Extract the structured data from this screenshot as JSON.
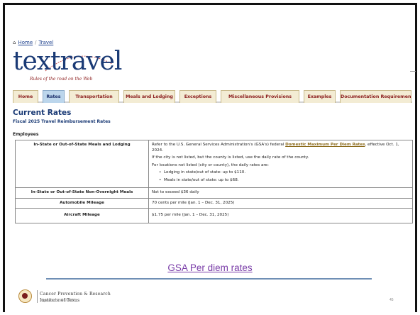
{
  "breadcrumb": {
    "home": "Home",
    "separator": "/",
    "current": "Travel"
  },
  "logo": {
    "wordmark": "textravel",
    "tagline": "Rules of the road on the Web"
  },
  "nav": {
    "tabs": [
      {
        "label": "Home",
        "active": false
      },
      {
        "label": "Rates",
        "active": true
      },
      {
        "label": "Transportation",
        "active": false
      },
      {
        "label": "Meals and Lodging",
        "active": false
      },
      {
        "label": "Exceptions",
        "active": false
      },
      {
        "label": "Miscellaneous Provisions",
        "active": false
      },
      {
        "label": "Examples",
        "active": false
      },
      {
        "label": "Documentation Requirements",
        "active": false
      }
    ]
  },
  "page": {
    "title": "Current Rates",
    "subtitle": "Fiscal 2025 Travel Reimbursement Rates",
    "section": "Employees"
  },
  "rates": {
    "row1": {
      "label": "In-State or Out-of-State Meals and Lodging",
      "p1_before": "Refer to the U.S. General Services Administration's (GSA's) federal ",
      "p1_link": "Domestic Maximum Per Diem Rates",
      "p1_after": ", effective Oct. 1, 2024.",
      "p2": "If the city is not listed, but the county is listed, use the daily rate of the county.",
      "p3": "For locations not listed (city or county), the daily rates are:",
      "bullet1": "Lodging in state/out of state: up to $110.",
      "bullet2": "Meals in state/out of state: up to $68."
    },
    "row2": {
      "label": "In-State or Out-of-State Non-Overnight Meals",
      "value": "Not to exceed $36 daily"
    },
    "row3": {
      "label": "Automobile Mileage",
      "value": "70 cents per mile (Jan. 1 – Dec. 31, 2025)"
    },
    "row4": {
      "label": "Aircraft Mileage",
      "value": "$1.75 per mile (Jan. 1 – Dec. 31, 2025)"
    }
  },
  "gsa_link": "GSA Per diem rates",
  "footer": {
    "org_line1": "Cancer Prevention & Research",
    "org_line2": "Institute of Texas",
    "updated": "Updated: 8/20/2025",
    "page_number": "45"
  },
  "colors": {
    "nav_tab_bg": "#f3ecd4",
    "nav_tab_active_bg": "#bcd6ec",
    "title_blue": "#1a3a75",
    "link_purple": "#7a3da8"
  }
}
